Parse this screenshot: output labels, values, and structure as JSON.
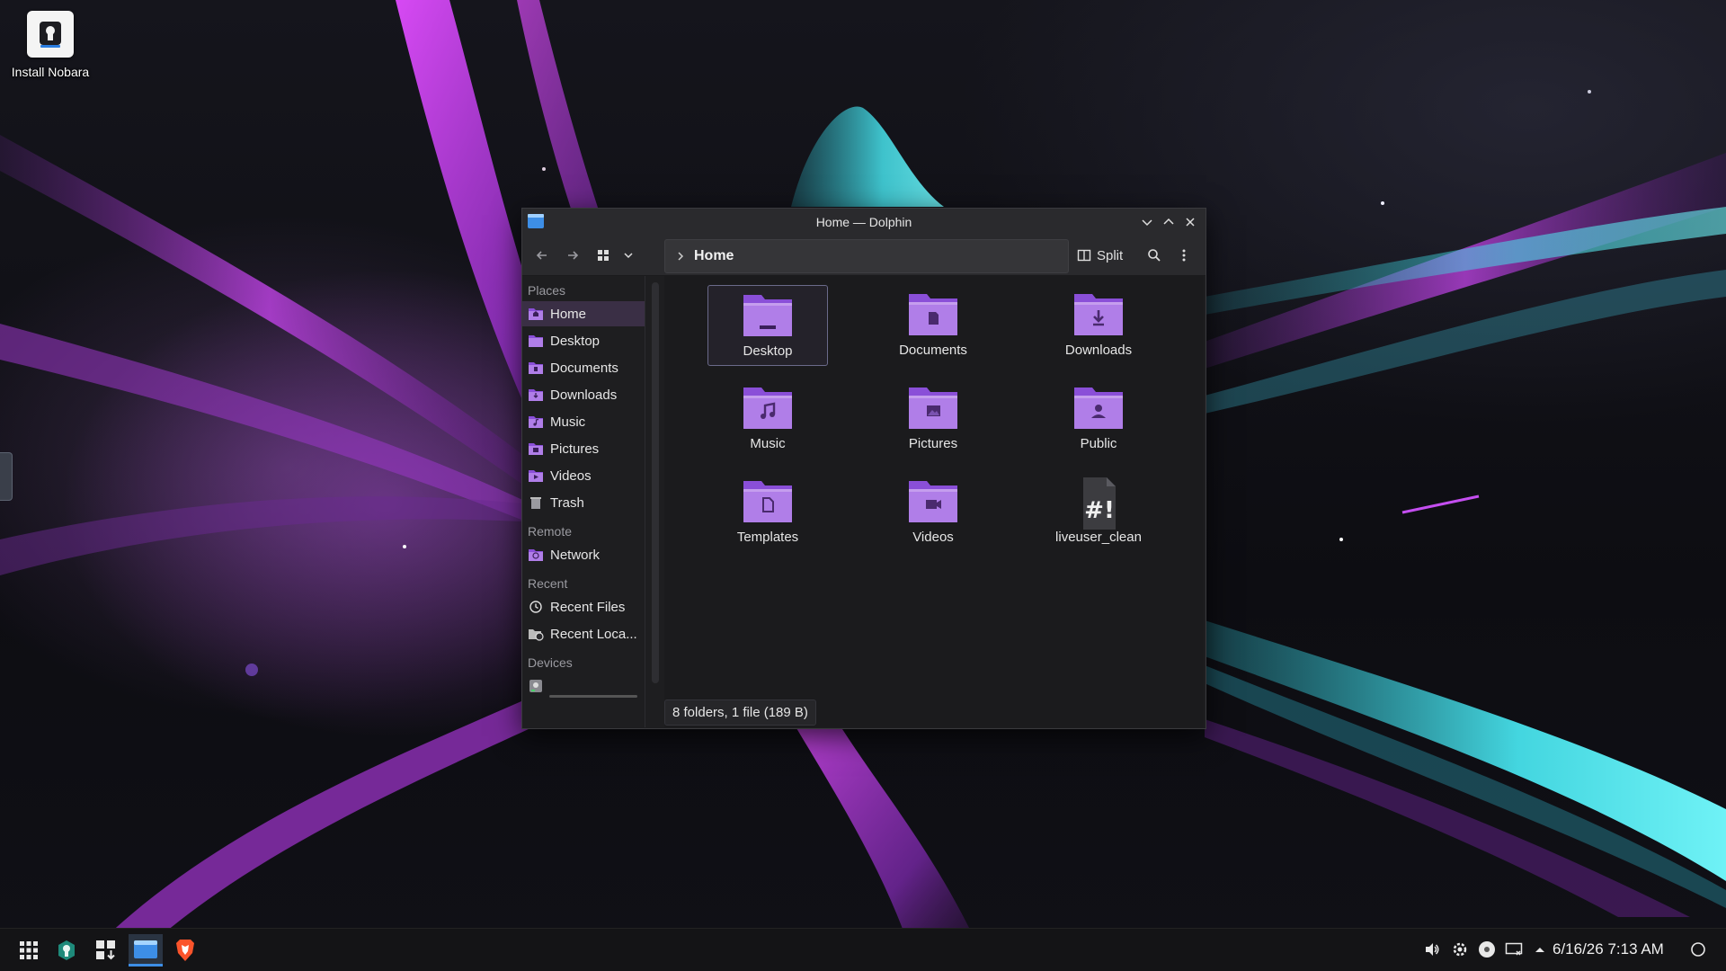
{
  "desktop": {
    "icons": [
      {
        "label": "Install Nobara",
        "icon": "installer-icon"
      }
    ]
  },
  "window": {
    "title": "Home — Dolphin",
    "controls": [
      "minimize-icon",
      "maximize-icon",
      "close-icon"
    ],
    "toolbar": {
      "back": "back-arrow-icon",
      "forward": "forward-arrow-icon",
      "view_mode": "icons-view-icon",
      "view_menu": "chevron-down-icon",
      "breadcrumb": "Home",
      "split_label": "Split",
      "search": "search-icon",
      "menu": "kebab-menu-icon"
    },
    "sidebar": {
      "sections": [
        {
          "title": "Places",
          "items": [
            {
              "label": "Home",
              "icon": "home-folder-icon",
              "active": true
            },
            {
              "label": "Desktop",
              "icon": "desktop-folder-icon"
            },
            {
              "label": "Documents",
              "icon": "documents-folder-icon"
            },
            {
              "label": "Downloads",
              "icon": "downloads-folder-icon"
            },
            {
              "label": "Music",
              "icon": "music-folder-icon"
            },
            {
              "label": "Pictures",
              "icon": "pictures-folder-icon"
            },
            {
              "label": "Videos",
              "icon": "videos-folder-icon"
            },
            {
              "label": "Trash",
              "icon": "trash-icon"
            }
          ]
        },
        {
          "title": "Remote",
          "items": [
            {
              "label": "Network",
              "icon": "network-folder-icon"
            }
          ]
        },
        {
          "title": "Recent",
          "items": [
            {
              "label": "Recent Files",
              "icon": "clock-icon"
            },
            {
              "label": "Recent Loca...",
              "icon": "recent-locations-icon"
            }
          ]
        },
        {
          "title": "Devices",
          "items": [
            {
              "label": "",
              "icon": "drive-icon"
            }
          ]
        }
      ]
    },
    "files": [
      {
        "name": "Desktop",
        "icon": "desktop-folder-icon",
        "selected": true
      },
      {
        "name": "Documents",
        "icon": "documents-folder-icon"
      },
      {
        "name": "Downloads",
        "icon": "downloads-folder-icon"
      },
      {
        "name": "Music",
        "icon": "music-folder-icon"
      },
      {
        "name": "Pictures",
        "icon": "pictures-folder-icon"
      },
      {
        "name": "Public",
        "icon": "public-folder-icon"
      },
      {
        "name": "Templates",
        "icon": "templates-folder-icon"
      },
      {
        "name": "Videos",
        "icon": "videos-folder-icon"
      },
      {
        "name": "liveuser_clean",
        "icon": "script-file-icon"
      }
    ],
    "status": "8 folders, 1 file (189 B)"
  },
  "taskbar": {
    "apps": [
      {
        "name": "app-launcher-icon"
      },
      {
        "name": "nobara-welcome-icon"
      },
      {
        "name": "software-store-icon"
      },
      {
        "name": "dolphin-icon",
        "active": true
      },
      {
        "name": "brave-browser-icon"
      }
    ],
    "tray": [
      "volume-icon",
      "settings-icon",
      "disc-icon",
      "display-icon",
      "tray-expand-icon"
    ],
    "clock": "6/16/26 7:13 AM",
    "extra": "power-icon"
  },
  "colors": {
    "folder_purple": "#8a4fd8",
    "folder_purple_light": "#b07ee8",
    "accent_blue": "#3d8ee6",
    "wallpaper_cyan": "#3ec9d4",
    "wallpaper_magenta": "#b23be0"
  }
}
